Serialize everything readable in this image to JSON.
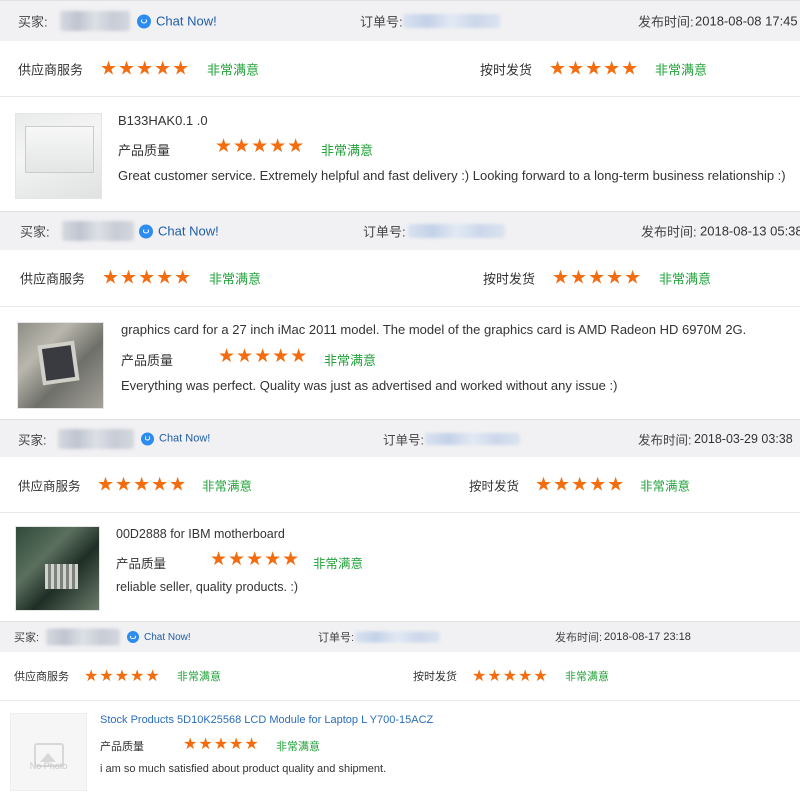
{
  "reviews": [
    {
      "buyer_label": "买家:",
      "chat_label": "Chat Now!",
      "order_label": "订单号:",
      "publish_label": "发布时间:",
      "publish_time": "2018-08-08 17:45",
      "supplier_service_label": "供应商服务",
      "supplier_service_stars": "★★★★★",
      "supplier_service_rating": "非常满意",
      "on_time_label": "按时发货",
      "on_time_stars": "★★★★★",
      "on_time_rating": "非常满意",
      "product_title": "B133HAK0.1 .0",
      "quality_label": "产品质量",
      "quality_stars": "★★★★★",
      "quality_rating": "非常满意",
      "comment": "Great customer service. Extremely helpful and fast delivery :) Looking forward to a long-term business relationship :)",
      "thumbnail": "lcd-panel-image"
    },
    {
      "buyer_label": "买家:",
      "chat_label": "Chat Now!",
      "order_label": "订单号:",
      "publish_label": "发布时间:",
      "publish_time": "2018-08-13 05:38",
      "supplier_service_label": "供应商服务",
      "supplier_service_stars": "★★★★★",
      "supplier_service_rating": "非常满意",
      "on_time_label": "按时发货",
      "on_time_stars": "★★★★★",
      "on_time_rating": "非常满意",
      "product_title": "graphics card for a 27 inch iMac 2011 model. The model of the graphics card is AMD Radeon HD 6970M 2G.",
      "quality_label": "产品质量",
      "quality_stars": "★★★★★",
      "quality_rating": "非常满意",
      "comment": "Everything was perfect. Quality was just as advertised and worked without any issue :)",
      "thumbnail": "graphics-card-image"
    },
    {
      "buyer_label": "买家:",
      "chat_label": "Chat Now!",
      "order_label": "订单号:",
      "publish_label": "发布时间:",
      "publish_time": "2018-03-29 03:38",
      "supplier_service_label": "供应商服务",
      "supplier_service_stars": "★★★★★",
      "supplier_service_rating": "非常满意",
      "on_time_label": "按时发货",
      "on_time_stars": "★★★★★",
      "on_time_rating": "非常满意",
      "product_title": "00D2888 for IBM motherboard",
      "quality_label": "产品质量",
      "quality_stars": "★★★★★",
      "quality_rating": "非常满意",
      "comment": "reliable seller, quality products. :)",
      "thumbnail": "motherboard-image"
    },
    {
      "buyer_label": "买家:",
      "chat_label": "Chat Now!",
      "order_label": "订单号:",
      "publish_label": "发布时间:",
      "publish_time": "2018-08-17 23:18",
      "supplier_service_label": "供应商服务",
      "supplier_service_stars": "★★★★★",
      "supplier_service_rating": "非常满意",
      "on_time_label": "按时发货",
      "on_time_stars": "★★★★★",
      "on_time_rating": "非常满意",
      "product_title": "Stock Products 5D10K25568 LCD Module for Laptop L Y700-15ACZ",
      "quality_label": "产品质量",
      "quality_stars": "★★★★★",
      "quality_rating": "非常满意",
      "comment": "i am so much satisfied about product quality and shipment.",
      "thumbnail": "no-photo-placeholder",
      "no_photo_text": "No Photo"
    }
  ],
  "colors": {
    "star": "#f36d10",
    "satisfied": "#22a13a",
    "link": "#2a6ebb",
    "chat": "#1f5ea8",
    "header_bg": "#f1f1f3"
  }
}
